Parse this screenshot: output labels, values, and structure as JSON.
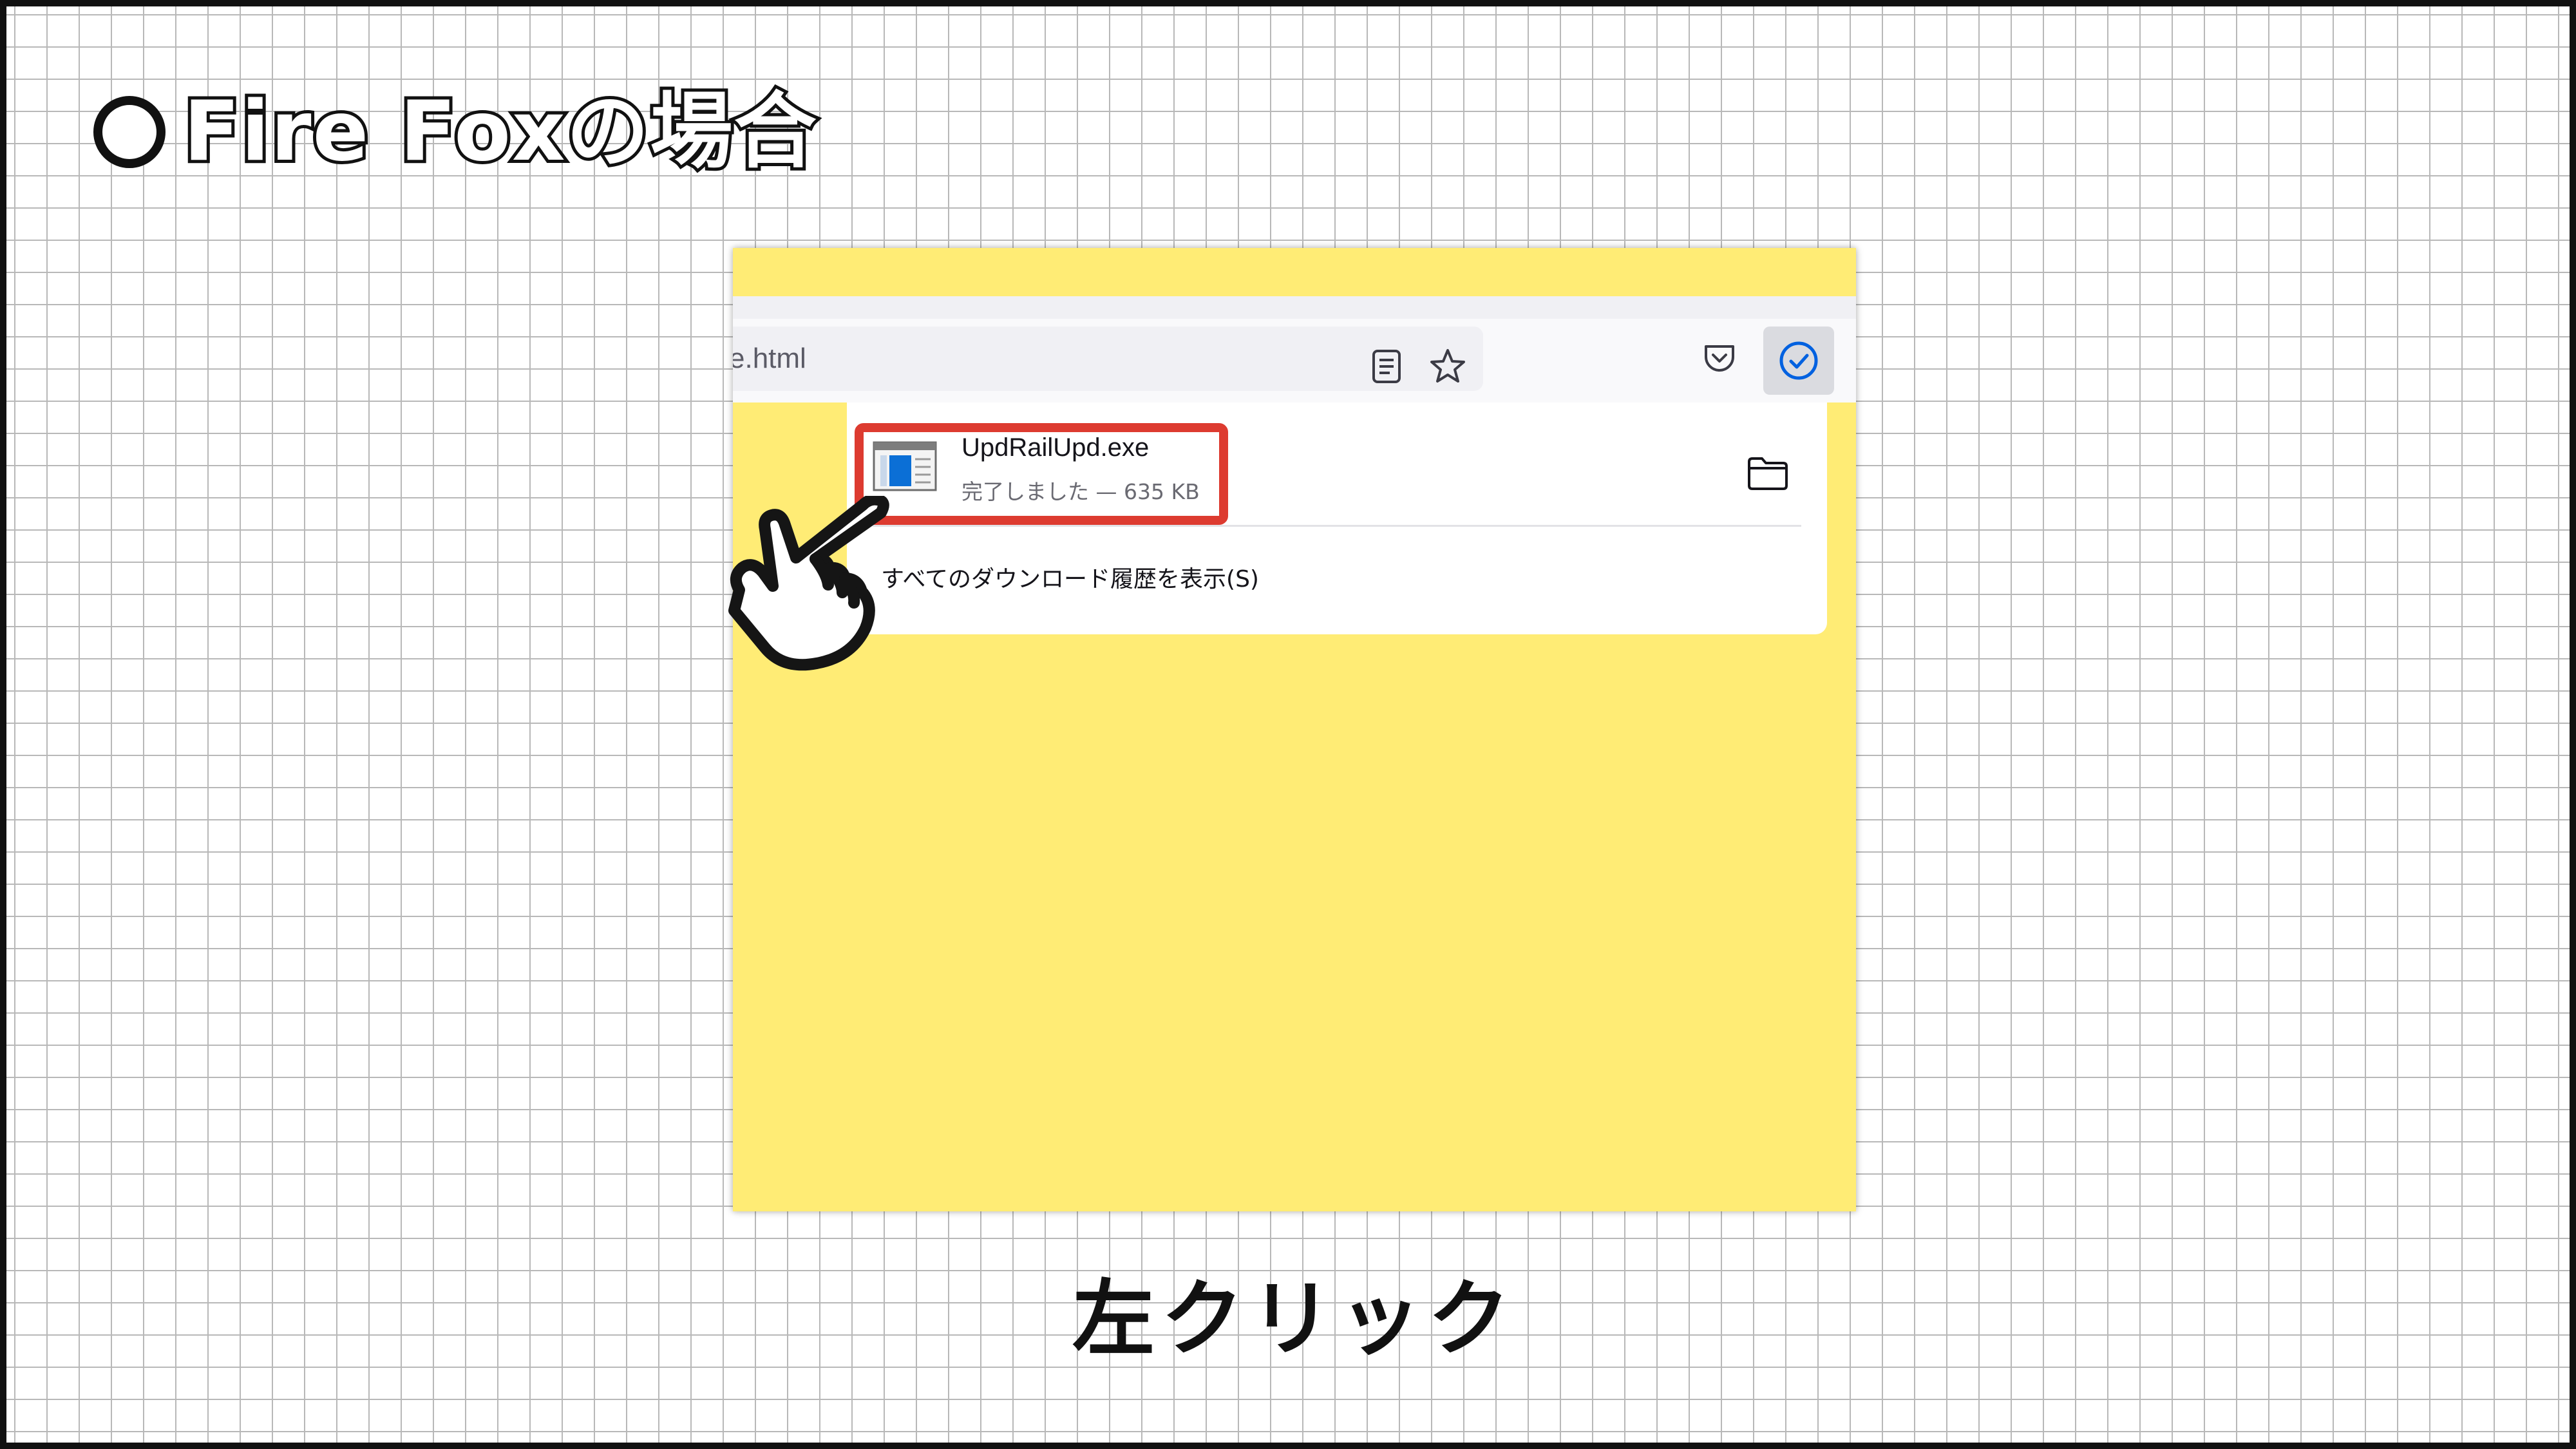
{
  "heading": {
    "text": "Fire Foxの場合"
  },
  "browser": {
    "url_fragment": "e.html",
    "toolbar_icons": [
      "reader-view-icon",
      "bookmark-star-icon",
      "pocket-icon",
      "downloads-check-icon"
    ],
    "page_background": "#ffec75",
    "downloads_accent": "#0061e0"
  },
  "downloads_panel": {
    "item": {
      "file_name": "UpdRailUpd.exe",
      "status": "完了しました — 635 KB",
      "file_icon": "exe-window-icon",
      "action_icon": "folder-icon"
    },
    "show_all_label": "すべてのダウンロード履歴を表示(S)"
  },
  "annotation": {
    "highlight_color": "#dd3b30",
    "pointer_icon": "pointing-hand-icon"
  },
  "caption": {
    "text": "左クリック"
  }
}
